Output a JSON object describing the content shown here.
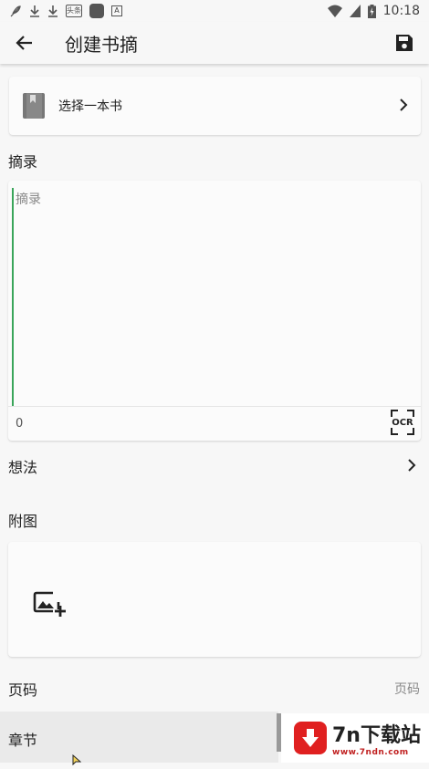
{
  "status_bar": {
    "time": "10:18",
    "box_icon_text": "头条",
    "a_icon_text": "A"
  },
  "app_bar": {
    "title": "创建书摘"
  },
  "book": {
    "select_label": "选择一本书"
  },
  "excerpt": {
    "section_label": "摘录",
    "placeholder": "摘录",
    "char_count": "0",
    "ocr_label": "OCR"
  },
  "thought": {
    "label": "想法"
  },
  "attachment": {
    "section_label": "附图"
  },
  "page": {
    "label": "页码",
    "placeholder": "页码"
  },
  "chapter": {
    "label": "章节"
  },
  "watermark": {
    "title": "7n下载站",
    "url": "www.7ndn.com"
  },
  "colors": {
    "accent_cursor": "#3aa55a",
    "watermark_red": "#e02020"
  }
}
